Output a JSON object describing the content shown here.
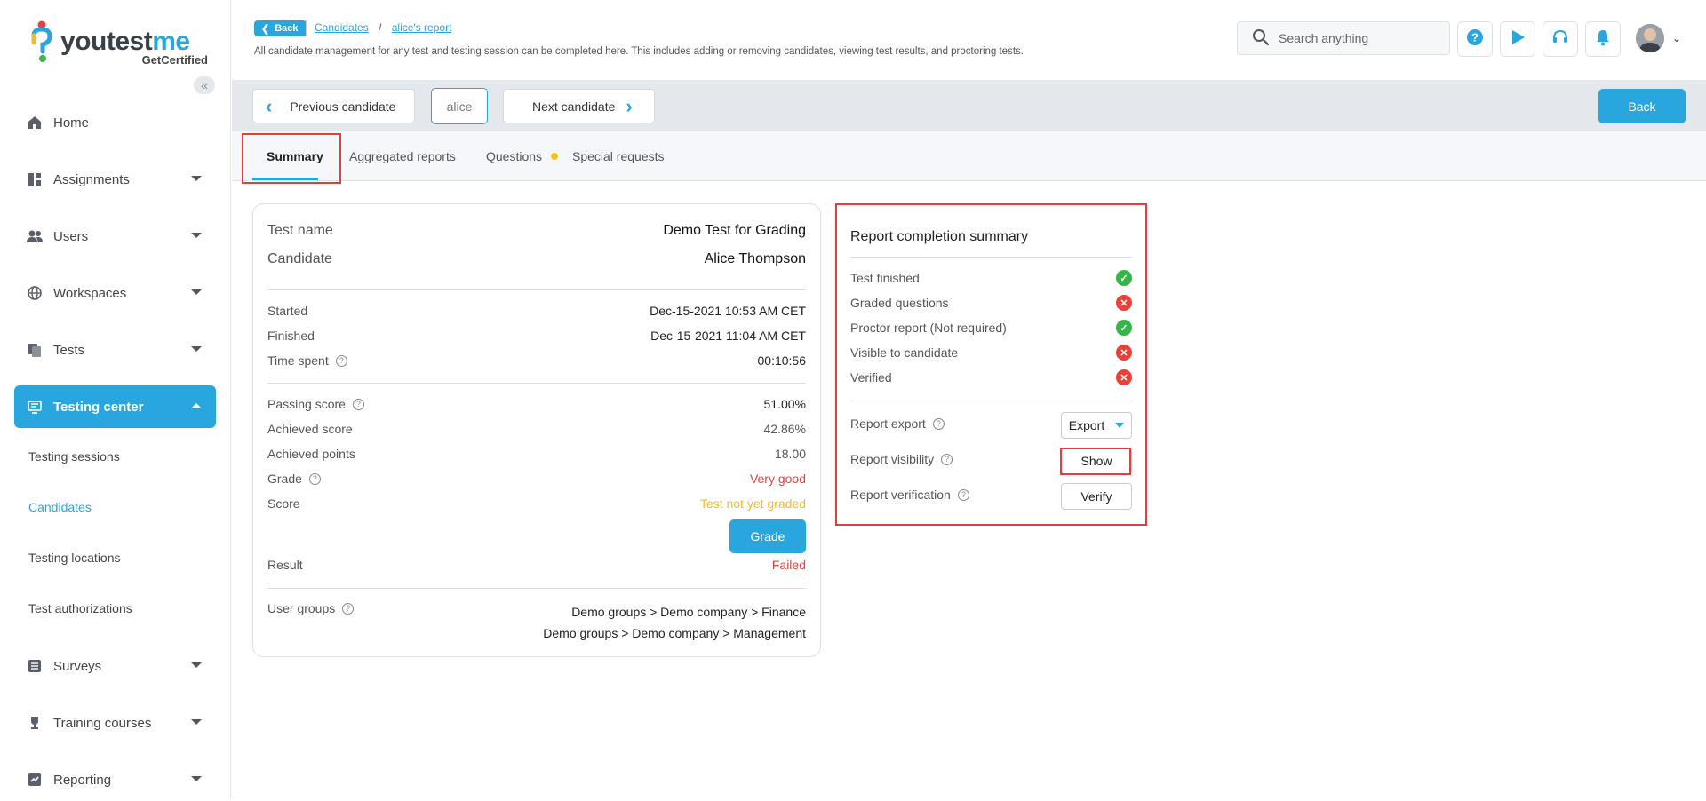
{
  "brand": {
    "name_part1": "youtest",
    "name_part2": "me",
    "tagline": "GetCertified"
  },
  "sidebar": {
    "collapse_label": "«",
    "items": [
      {
        "label": "Home",
        "icon": "home-icon"
      },
      {
        "label": "Assignments",
        "icon": "assignments-icon"
      },
      {
        "label": "Users",
        "icon": "users-icon"
      },
      {
        "label": "Workspaces",
        "icon": "globe-icon"
      },
      {
        "label": "Tests",
        "icon": "tests-icon"
      },
      {
        "label": "Testing center",
        "icon": "testing-center-icon"
      },
      {
        "label": "Surveys",
        "icon": "surveys-icon"
      },
      {
        "label": "Training courses",
        "icon": "trophy-icon"
      },
      {
        "label": "Reporting",
        "icon": "reporting-icon"
      }
    ],
    "sub_items": [
      "Testing sessions",
      "Candidates",
      "Testing locations",
      "Test authorizations"
    ]
  },
  "header": {
    "back_label": "Back",
    "breadcrumb": [
      "Candidates",
      "alice's report"
    ],
    "breadcrumb_sep": "/",
    "description": "All candidate management for any test and testing session can be completed here. This includes adding or removing candidates, viewing test results, and proctoring tests.",
    "search_placeholder": "Search anything"
  },
  "toolbar": {
    "prev_label": "Previous candidate",
    "current_candidate": "alice",
    "next_label": "Next candidate",
    "back_label": "Back"
  },
  "tabs": [
    {
      "label": "Summary"
    },
    {
      "label": "Aggregated reports"
    },
    {
      "label": "Questions"
    },
    {
      "label": "Special requests"
    }
  ],
  "details": {
    "test_name_label": "Test name",
    "test_name": "Demo Test for Grading",
    "candidate_label": "Candidate",
    "candidate": "Alice Thompson",
    "started_label": "Started",
    "started": "Dec-15-2021 10:53 AM CET",
    "finished_label": "Finished",
    "finished": "Dec-15-2021 11:04 AM CET",
    "time_spent_label": "Time spent",
    "time_spent": "00:10:56",
    "passing_score_label": "Passing score",
    "passing_score": "51.00%",
    "achieved_score_label": "Achieved score",
    "achieved_score": "42.86%",
    "achieved_points_label": "Achieved points",
    "achieved_points": "18.00",
    "grade_label": "Grade",
    "grade": "Very good",
    "score_label": "Score",
    "score": "Test not yet graded",
    "grade_button": "Grade",
    "result_label": "Result",
    "result": "Failed",
    "user_groups_label": "User groups",
    "user_groups": [
      "Demo groups > Demo company > Finance",
      "Demo groups > Demo company > Management"
    ]
  },
  "summary": {
    "title": "Report completion summary",
    "checks": [
      {
        "label": "Test finished",
        "status": "ok"
      },
      {
        "label": "Graded questions",
        "status": "bad"
      },
      {
        "label": "Proctor report (Not required)",
        "status": "ok"
      },
      {
        "label": "Visible to candidate",
        "status": "bad"
      },
      {
        "label": "Verified",
        "status": "bad"
      }
    ],
    "export_label": "Report export",
    "export_button": "Export",
    "visibility_label": "Report visibility",
    "visibility_button": "Show",
    "verification_label": "Report verification",
    "verification_button": "Verify"
  },
  "colors": {
    "accent": "#2aa6de",
    "danger": "#e8413a",
    "success": "#35b548",
    "warning": "#f5b82e",
    "highlight": "#e0403a"
  }
}
